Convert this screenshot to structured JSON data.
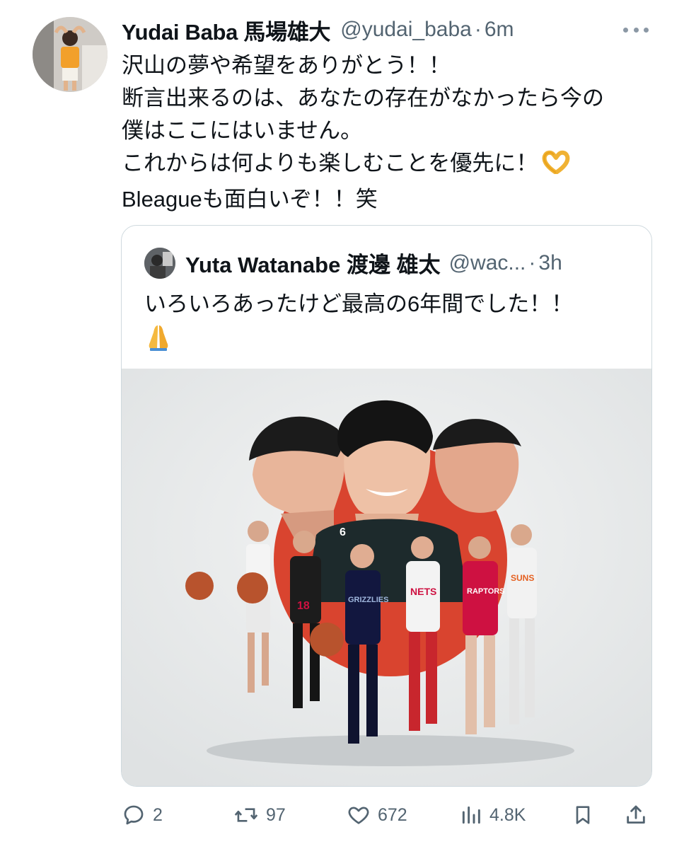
{
  "tweet": {
    "author_name": "Yudai Baba 馬場雄大",
    "author_handle": "@yudai_baba",
    "separator": "·",
    "time": "6m",
    "text_lines": [
      "沢山の夢や希望をありがとう！！",
      "断言出来るのは、あなたの存在がなかったら今の",
      "僕はここにはいません。",
      "これからは何よりも楽しむことを優先に！",
      "Bleagueも面白いぞ！！笑"
    ],
    "inline_emoji": "heart-hands-emoji"
  },
  "quoted": {
    "author_name": "Yuta Watanabe 渡邊 雄太",
    "author_handle": "@wac...",
    "separator": "·",
    "time": "3h",
    "text": "いろいろあったけど最高の6年間でした！！",
    "emoji": "folded-hands-emoji",
    "image_jersey_labels": [
      "6",
      "18",
      "RAPTORS",
      "GRIZZLIES",
      "NETS",
      "SUNS"
    ]
  },
  "actions": {
    "reply_count": "2",
    "retweet_count": "97",
    "like_count": "672",
    "views_count": "4.8K"
  },
  "colors": {
    "text": "#0f1419",
    "muted": "#536471",
    "border": "#cfd9de",
    "raptors_red": "#ce1141",
    "grizzlies_navy": "#12173f"
  }
}
